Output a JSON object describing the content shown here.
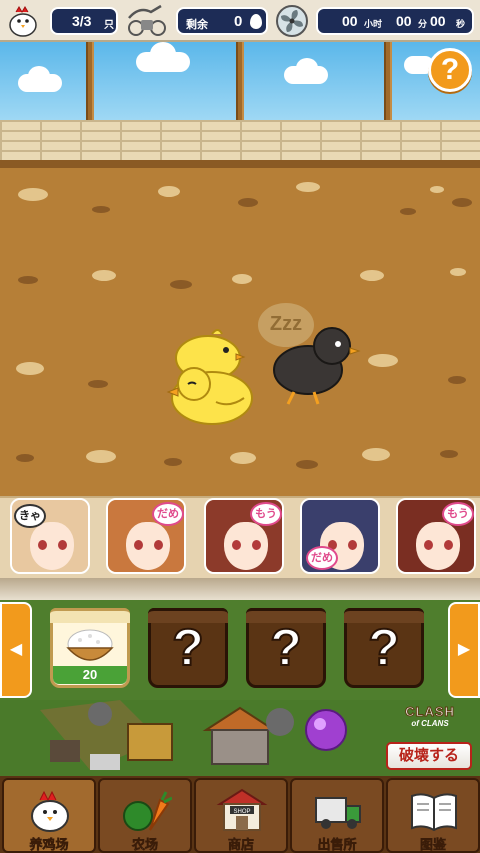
{
  "status": {
    "chicken_count": "3/3",
    "chicken_unit": "只",
    "remaining_label": "剩余",
    "remaining_eggs": "0",
    "timer": {
      "hours": "00",
      "hours_unit": "小时",
      "minutes": "00",
      "minutes_unit": "分",
      "seconds": "00",
      "seconds_unit": "秒"
    }
  },
  "help": {
    "label": "?"
  },
  "girls": [
    {
      "bubble": "きゃ",
      "hair": "#e8c8a0"
    },
    {
      "bubble": "だめ",
      "hair": "#c9783e"
    },
    {
      "bubble": "もう",
      "hair": "#8c3a2a"
    },
    {
      "bubble": "だめ",
      "hair": "#3a3f6c"
    },
    {
      "bubble": "もう",
      "hair": "#7a2e22"
    }
  ],
  "shelf": {
    "rice_count": "20",
    "locked_label": "?"
  },
  "ad": {
    "brand_line1": "CLASH",
    "brand_line2": "of CLANS",
    "cta": "破壊する"
  },
  "nav": [
    {
      "label": "养鸡场",
      "icon": "chicken-icon",
      "active": true
    },
    {
      "label": "农场",
      "icon": "vegetables-icon",
      "active": false
    },
    {
      "label": "商店",
      "icon": "shop-icon",
      "active": false
    },
    {
      "label": "出售所",
      "icon": "truck-icon",
      "active": false
    },
    {
      "label": "图鉴",
      "icon": "book-icon",
      "active": false
    }
  ],
  "colors": {
    "accent": "#f29a1c",
    "navy": "#1d2c56",
    "green": "#4aa237"
  }
}
